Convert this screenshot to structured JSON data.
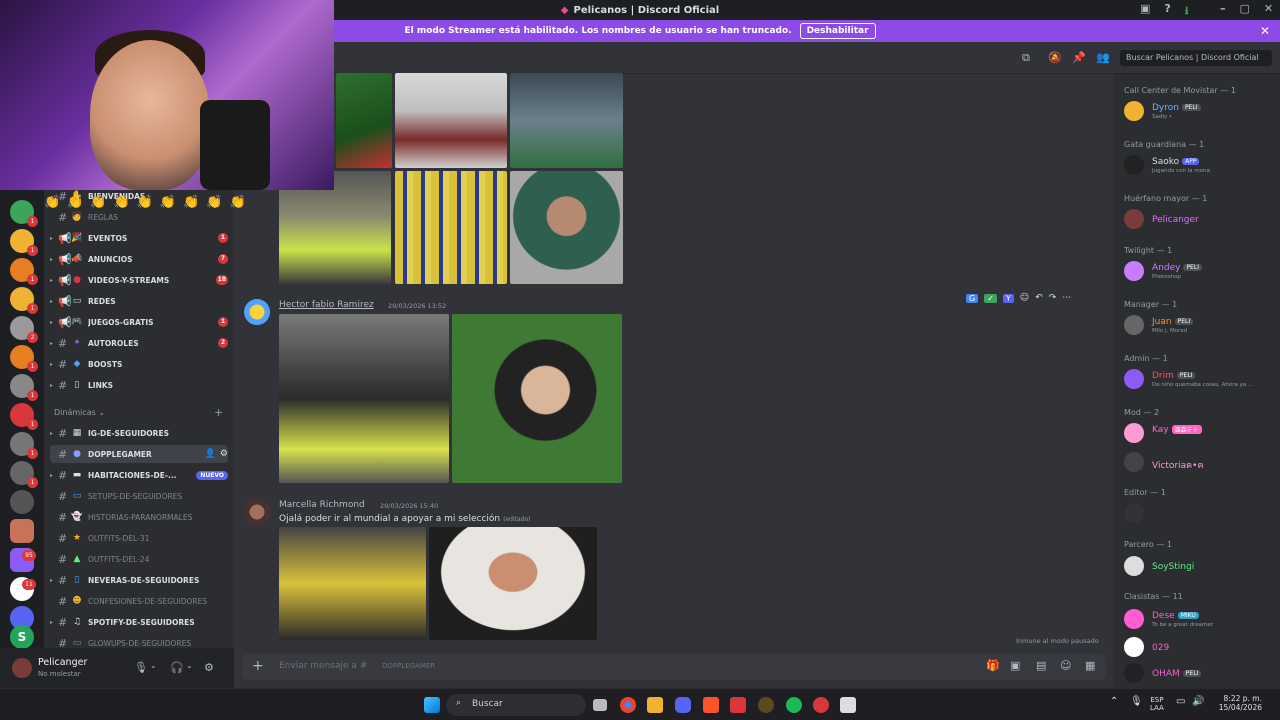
{
  "window": {
    "title": "Pelicanos | Discord Oficial"
  },
  "streamer_bar": {
    "text": "El modo Streamer está habilitado. Los nombres de usuario se han truncado.",
    "button": "Deshabilitar"
  },
  "topbar": {
    "search_placeholder": "Buscar Pelicanos | Discord Oficial"
  },
  "channels": [
    {
      "name": "bienvenidas",
      "icon": "wave",
      "unread": true,
      "count": ""
    },
    {
      "name": "reglas",
      "icon": "rules",
      "unread": false,
      "count": ""
    },
    {
      "name": "eventos",
      "icon": "megaphone",
      "unread": true,
      "count": "1"
    },
    {
      "name": "anuncios",
      "icon": "megaphone",
      "unread": true,
      "count": "7"
    },
    {
      "name": "videos-y-streams",
      "icon": "red-dot",
      "unread": true,
      "count": "18"
    },
    {
      "name": "redes",
      "icon": "monitor",
      "unread": true,
      "count": ""
    },
    {
      "name": "juegos-gratis",
      "icon": "gamepad",
      "unread": true,
      "count": "1"
    },
    {
      "name": "autoroles",
      "icon": "sparkle",
      "unread": true,
      "count": "2"
    },
    {
      "name": "boosts",
      "icon": "gem",
      "unread": true,
      "count": ""
    },
    {
      "name": "links",
      "icon": "page",
      "unread": true,
      "count": ""
    }
  ],
  "category": {
    "name": "Dinámicas"
  },
  "channels2": [
    {
      "name": "ig-de-seguidores",
      "unread": true,
      "badge": ""
    },
    {
      "name": "dopplegamer",
      "unread": true,
      "badge": "",
      "active": true
    },
    {
      "name": "habitaciones-de-...",
      "unread": true,
      "badge": "NUEVO"
    },
    {
      "name": "setups-de-seguidores",
      "unread": false,
      "badge": ""
    },
    {
      "name": "historias-paranormales",
      "unread": false,
      "badge": ""
    },
    {
      "name": "outfits-del-31",
      "unread": false,
      "badge": ""
    },
    {
      "name": "outfits-del-24",
      "unread": false,
      "badge": ""
    },
    {
      "name": "neveras-de-seguidores",
      "unread": true,
      "badge": ""
    },
    {
      "name": "confesiones-de-seguidores",
      "unread": false,
      "badge": ""
    },
    {
      "name": "spotify-de-seguidores",
      "unread": true,
      "badge": ""
    },
    {
      "name": "glowups-de-seguidores",
      "unread": false,
      "badge": ""
    }
  ],
  "guild_badges": [
    "1",
    "1",
    "1",
    "1",
    "2",
    "1",
    "1",
    "1",
    "1",
    "1",
    "95",
    "11"
  ],
  "user": {
    "name": "Pelicanger",
    "status": "No molestar"
  },
  "messages": [
    {
      "author": "Hector fabio Ramirez",
      "timestamp": "29/03/2026 13:52",
      "text": ""
    },
    {
      "author": "Marcella Richmond",
      "timestamp": "29/03/2026 15:40",
      "text": "Ojalá poder ir al mundial a apoyar a mi selección",
      "edited": "(editado)"
    }
  ],
  "message_tools": [
    "G",
    "✓",
    "Y"
  ],
  "composer": {
    "placeholder": "Enviar mensaje a #",
    "channel": "DOPPLEGAMER",
    "note": "Inmune al modo pausado"
  },
  "members": {
    "groups": [
      {
        "name": "Call Center de Movistar — 1",
        "members": [
          {
            "name": "Dyron",
            "tag": "PELI",
            "sub": "Sadly •",
            "color": "#66b3ff"
          }
        ]
      },
      {
        "name": "Gata guardiana — 1",
        "members": [
          {
            "name": "Saoko",
            "tag": "APP",
            "sub": "Jugando con la mona",
            "color": "#dbdee1"
          }
        ]
      },
      {
        "name": "Huérfano mayor — 1",
        "members": [
          {
            "name": "Pelicanger",
            "tag": "",
            "sub": "",
            "color": "#e06cff"
          }
        ]
      },
      {
        "name": "Twilight — 1",
        "members": [
          {
            "name": "Andey",
            "tag": "PELI",
            "sub": "Photoshop",
            "color": "#c77dff"
          }
        ]
      },
      {
        "name": "Manager — 1",
        "members": [
          {
            "name": "Juan",
            "tag": "PELI",
            "sub": "Milo j, Morad",
            "color": "#ff8c3a"
          }
        ]
      },
      {
        "name": "Admin — 1",
        "members": [
          {
            "name": "Drim",
            "tag": "PELI",
            "sub": "De niño quemaba cosas, Ahora ya ...",
            "color": "#ff4d6d"
          }
        ]
      },
      {
        "name": "Mod — 2",
        "members": [
          {
            "name": "Kay",
            "tag": "亜森テト",
            "sub": "",
            "color": "#ff66c4"
          },
          {
            "name": "Victoriaฅ•ฅ",
            "tag": "",
            "sub": "",
            "color": "#ff9ad5"
          }
        ]
      },
      {
        "name": "Editor — 1",
        "members": [
          {
            "name": "",
            "tag": "",
            "sub": "",
            "color": "#5865f2"
          }
        ]
      },
      {
        "name": "Parcero — 1",
        "members": [
          {
            "name": "SoyStingi",
            "tag": "",
            "sub": "",
            "color": "#57f287"
          }
        ]
      },
      {
        "name": "Clasistas — 11",
        "members": [
          {
            "name": "Dese",
            "tag": "MIKU",
            "sub": "To be a great dreamer",
            "color": "#ff5fd2"
          },
          {
            "name": "029",
            "tag": "",
            "sub": "",
            "color": "#ff5fd2"
          },
          {
            "name": "OHAM",
            "tag": "PELI",
            "sub": "",
            "color": "#ff5fd2"
          }
        ]
      }
    ]
  },
  "taskbar": {
    "search": "Buscar",
    "lang": "ESP",
    "lang2": "LAA",
    "time": "8:22 p. m.",
    "date": "15/04/2026"
  }
}
